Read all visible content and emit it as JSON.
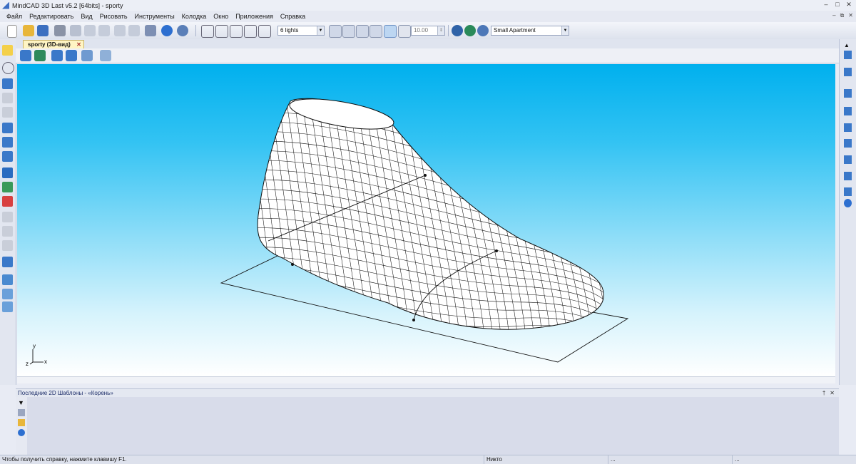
{
  "window": {
    "title": "MindCAD 3D Last v5.2 [64bits] - sporty"
  },
  "menu": [
    "Файл",
    "Редактировать",
    "Вид",
    "Рисовать",
    "Инструменты",
    "Колодка",
    "Окно",
    "Приложения",
    "Справка"
  ],
  "toolbar": {
    "lights_value": "6 lights",
    "scale_value": "10.00",
    "environment_value": "Small Apartment"
  },
  "document": {
    "tab_label": "sporty (3D-вид)"
  },
  "axes": {
    "y": "y",
    "z": "z",
    "x": "x"
  },
  "panel": {
    "title": "Последние 2D Шаблоны - «Корень»"
  },
  "status": {
    "help": "Чтобы получить справку, нажмите клавишу F1.",
    "selection": "Никто",
    "cell1": "...",
    "cell2": "..."
  },
  "colors": {
    "viewport_top": "#00b0ee",
    "viewport_bottom": "#ffffff",
    "mesh": "#111111",
    "tab_bg": "#fff5c4"
  }
}
